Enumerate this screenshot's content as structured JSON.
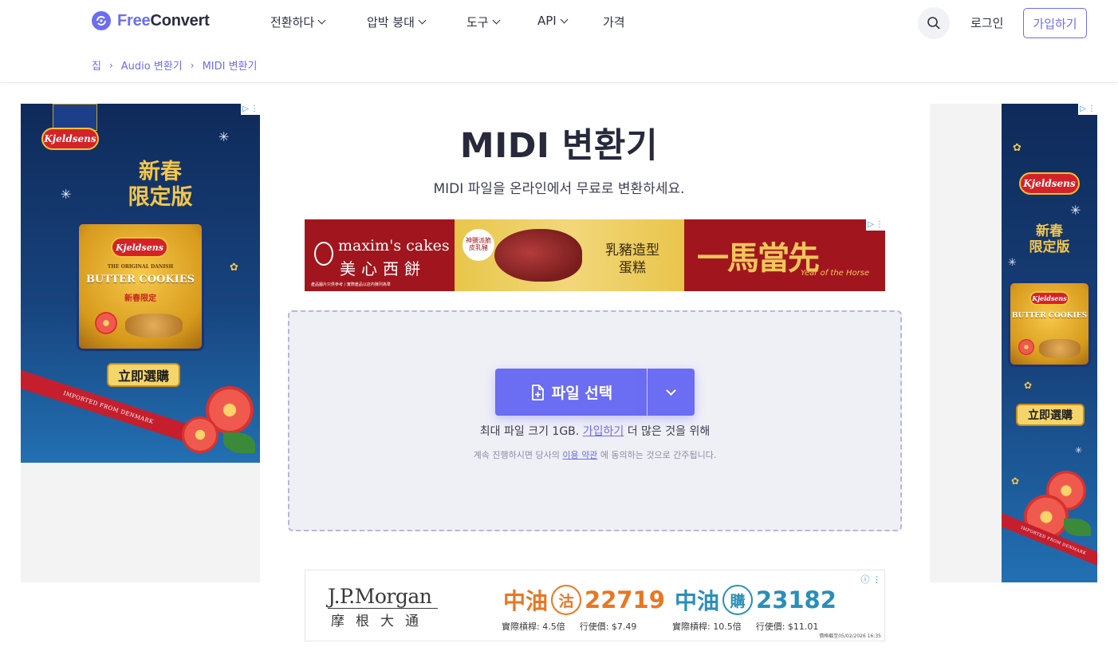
{
  "header": {
    "logo": {
      "brand_a": "Free",
      "brand_b": "Convert"
    },
    "nav": [
      {
        "label": "전환하다"
      },
      {
        "label": "압박 붕대"
      },
      {
        "label": "도구"
      },
      {
        "label": "API"
      },
      {
        "label": "가격"
      }
    ],
    "login_label": "로그인",
    "signup_label": "가입하기"
  },
  "breadcrumb": {
    "home": "집",
    "parent": "Audio 변환기",
    "current": "MIDI 변환기"
  },
  "main": {
    "title": "MIDI 변환기",
    "subtitle": "MIDI 파일을 온라인에서 무료로 변환하세요.",
    "choose_button": "파일 선택",
    "limit_prefix": "최대 파일 크기 1GB.",
    "limit_link": "가입하기",
    "limit_suffix": "더 많은 것을 위해",
    "terms_prefix": "계속 진행하시면 당사의",
    "terms_link": "이용 약관",
    "terms_suffix": "에 동의하는 것으로 간주됩니다."
  },
  "ads": {
    "kjeldsens": {
      "brand": "Kjeldsens",
      "headline_line1": "新春",
      "headline_line2": "限定版",
      "tin_label1": "BUTTER COOKIES",
      "tin_label2": "新春限定",
      "tin_small": "THE ORIGINAL DANISH",
      "buy": "立即選購",
      "ribbon": "IMPORTED FROM DENMARK"
    },
    "maxim": {
      "brand_en": "maxim's cakes",
      "brand_cn": "美心西餅",
      "tag_cn": "神鹽派脆皮乳豬",
      "product_cn1": "乳豬造型",
      "product_cn2": "蛋糕",
      "slogan_cn": "一馬當先",
      "slogan_en": "Year of the Horse",
      "fineprint": "產品圖片只供參考 / 實際產品以店內陳列為準"
    },
    "jpmorgan": {
      "logo_en": "J.P.Morgan",
      "logo_cn": "摩根大通",
      "left_prefix": "中油",
      "left_badge": "沽",
      "left_code": "22719",
      "left_leverage": "實際槓桿: 4.5倍",
      "left_price": "行使價: $7.49",
      "right_prefix": "中油",
      "right_badge": "購",
      "right_code": "23182",
      "right_leverage": "實際槓桿: 10.5倍",
      "right_price": "行使價: $11.01",
      "footnote": "價格截至05/02/2026 16:35",
      "color_put": "#e87722",
      "color_call": "#2a8fb8"
    }
  },
  "colors": {
    "accent": "#6b6df2",
    "title": "#262a3b"
  }
}
